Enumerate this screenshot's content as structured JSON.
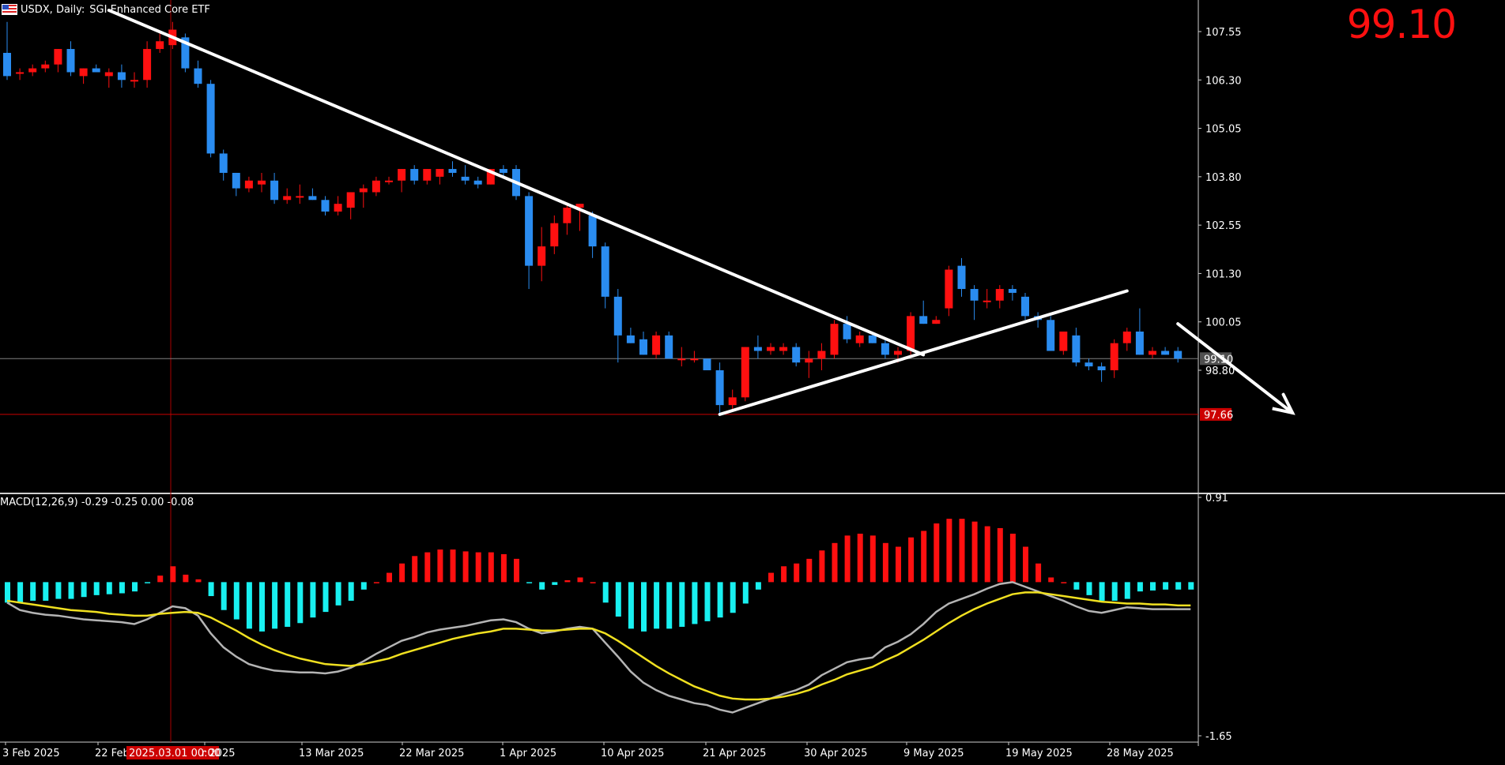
{
  "header": {
    "symbol": "USDX, Daily:",
    "description": "SGI Enhanced Core ETF",
    "flag_icon": "us-flag-icon"
  },
  "last_price": "99.10",
  "colors": {
    "background": "#000000",
    "bull": "#ff1010",
    "bear": "#2a8cf0",
    "hist_pos": "#ff1010",
    "hist_neg": "#19f0f0",
    "macd_line": "#b4b4b4",
    "signal_line": "#f0e020",
    "trendline": "#ffffff",
    "support": "#cc0000"
  },
  "indicator": {
    "label": "MACD(12,26,9) -0.29 -0.25 0.00 -0.08"
  },
  "crosshair_time_label": "2025.03.01 00:00",
  "chart_data": [
    {
      "type": "candlestick",
      "title": "USDX, Daily: SGI Enhanced Core ETF",
      "price_axis_ticks": [
        "107.55",
        "106.30",
        "105.05",
        "103.80",
        "102.55",
        "101.30",
        "100.05",
        "98.80"
      ],
      "price_range": [
        96.6,
        108.0
      ],
      "time_axis_labels": [
        "3 Feb 2025",
        "22 Feb 2025",
        "2025.03.01 00:00",
        "r 2025",
        "13 Mar 2025",
        "22 Mar 2025",
        "1 Apr 2025",
        "10 Apr 2025",
        "21 Apr 2025",
        "30 Apr 2025",
        "9 May 2025",
        "19 May 2025",
        "28 May 2025"
      ],
      "current_price_line": {
        "value": 99.1,
        "label": "99.10"
      },
      "support_line": {
        "value": 97.66,
        "label": "97.66"
      },
      "candles": [
        {
          "o": 107.0,
          "h": 107.8,
          "l": 106.3,
          "c": 106.4
        },
        {
          "o": 106.5,
          "h": 106.6,
          "l": 106.3,
          "c": 106.5
        },
        {
          "o": 106.5,
          "h": 106.7,
          "l": 106.4,
          "c": 106.6
        },
        {
          "o": 106.6,
          "h": 106.8,
          "l": 106.5,
          "c": 106.7
        },
        {
          "o": 106.7,
          "h": 107.1,
          "l": 106.5,
          "c": 107.1
        },
        {
          "o": 107.1,
          "h": 107.3,
          "l": 106.4,
          "c": 106.5
        },
        {
          "o": 106.4,
          "h": 106.6,
          "l": 106.2,
          "c": 106.6
        },
        {
          "o": 106.6,
          "h": 106.7,
          "l": 106.5,
          "c": 106.5
        },
        {
          "o": 106.4,
          "h": 106.6,
          "l": 106.1,
          "c": 106.5
        },
        {
          "o": 106.5,
          "h": 106.7,
          "l": 106.1,
          "c": 106.3
        },
        {
          "o": 106.3,
          "h": 106.5,
          "l": 106.1,
          "c": 106.3
        },
        {
          "o": 106.3,
          "h": 107.3,
          "l": 106.1,
          "c": 107.1
        },
        {
          "o": 107.1,
          "h": 107.5,
          "l": 107.0,
          "c": 107.3
        },
        {
          "o": 107.2,
          "h": 107.8,
          "l": 107.1,
          "c": 107.6
        },
        {
          "o": 107.4,
          "h": 107.5,
          "l": 106.5,
          "c": 106.6
        },
        {
          "o": 106.6,
          "h": 106.8,
          "l": 106.1,
          "c": 106.2
        },
        {
          "o": 106.2,
          "h": 106.3,
          "l": 104.3,
          "c": 104.4
        },
        {
          "o": 104.4,
          "h": 104.5,
          "l": 103.7,
          "c": 103.9
        },
        {
          "o": 103.9,
          "h": 103.9,
          "l": 103.3,
          "c": 103.5
        },
        {
          "o": 103.5,
          "h": 103.8,
          "l": 103.4,
          "c": 103.7
        },
        {
          "o": 103.6,
          "h": 103.9,
          "l": 103.4,
          "c": 103.7
        },
        {
          "o": 103.7,
          "h": 103.9,
          "l": 103.1,
          "c": 103.2
        },
        {
          "o": 103.2,
          "h": 103.5,
          "l": 103.1,
          "c": 103.3
        },
        {
          "o": 103.3,
          "h": 103.6,
          "l": 103.1,
          "c": 103.3
        },
        {
          "o": 103.3,
          "h": 103.5,
          "l": 103.2,
          "c": 103.2
        },
        {
          "o": 103.2,
          "h": 103.3,
          "l": 102.8,
          "c": 102.9
        },
        {
          "o": 102.9,
          "h": 103.3,
          "l": 102.8,
          "c": 103.1
        },
        {
          "o": 103.0,
          "h": 103.4,
          "l": 102.7,
          "c": 103.4
        },
        {
          "o": 103.4,
          "h": 103.6,
          "l": 103.0,
          "c": 103.5
        },
        {
          "o": 103.4,
          "h": 103.8,
          "l": 103.3,
          "c": 103.7
        },
        {
          "o": 103.7,
          "h": 103.8,
          "l": 103.6,
          "c": 103.7
        },
        {
          "o": 103.7,
          "h": 104.0,
          "l": 103.4,
          "c": 104.0
        },
        {
          "o": 104.0,
          "h": 104.1,
          "l": 103.6,
          "c": 103.7
        },
        {
          "o": 103.7,
          "h": 104.0,
          "l": 103.6,
          "c": 104.0
        },
        {
          "o": 103.8,
          "h": 104.0,
          "l": 103.6,
          "c": 104.0
        },
        {
          "o": 104.0,
          "h": 104.2,
          "l": 103.8,
          "c": 103.9
        },
        {
          "o": 103.8,
          "h": 104.1,
          "l": 103.6,
          "c": 103.7
        },
        {
          "o": 103.7,
          "h": 103.8,
          "l": 103.5,
          "c": 103.6
        },
        {
          "o": 103.6,
          "h": 104.0,
          "l": 103.6,
          "c": 104.0
        },
        {
          "o": 104.0,
          "h": 104.1,
          "l": 103.8,
          "c": 103.9
        },
        {
          "o": 104.0,
          "h": 104.1,
          "l": 103.2,
          "c": 103.3
        },
        {
          "o": 103.3,
          "h": 103.4,
          "l": 100.9,
          "c": 101.5
        },
        {
          "o": 101.5,
          "h": 102.5,
          "l": 101.1,
          "c": 102.0
        },
        {
          "o": 102.0,
          "h": 102.8,
          "l": 101.8,
          "c": 102.6
        },
        {
          "o": 102.6,
          "h": 103.1,
          "l": 102.3,
          "c": 103.0
        },
        {
          "o": 103.0,
          "h": 103.1,
          "l": 102.4,
          "c": 103.1
        },
        {
          "o": 102.8,
          "h": 102.9,
          "l": 101.7,
          "c": 102.0
        },
        {
          "o": 102.0,
          "h": 102.1,
          "l": 100.4,
          "c": 100.7
        },
        {
          "o": 100.7,
          "h": 100.9,
          "l": 99.0,
          "c": 99.7
        },
        {
          "o": 99.7,
          "h": 99.9,
          "l": 99.5,
          "c": 99.5
        },
        {
          "o": 99.6,
          "h": 99.8,
          "l": 99.2,
          "c": 99.2
        },
        {
          "o": 99.2,
          "h": 99.8,
          "l": 99.1,
          "c": 99.7
        },
        {
          "o": 99.7,
          "h": 99.8,
          "l": 99.1,
          "c": 99.1
        },
        {
          "o": 99.1,
          "h": 99.4,
          "l": 98.9,
          "c": 99.1
        },
        {
          "o": 99.1,
          "h": 99.3,
          "l": 99.0,
          "c": 99.1
        },
        {
          "o": 99.1,
          "h": 99.1,
          "l": 98.8,
          "c": 98.8
        },
        {
          "o": 98.8,
          "h": 99.0,
          "l": 97.7,
          "c": 97.9
        },
        {
          "o": 97.9,
          "h": 98.3,
          "l": 97.8,
          "c": 98.1
        },
        {
          "o": 98.1,
          "h": 99.4,
          "l": 98.0,
          "c": 99.4
        },
        {
          "o": 99.4,
          "h": 99.7,
          "l": 99.1,
          "c": 99.3
        },
        {
          "o": 99.3,
          "h": 99.5,
          "l": 99.2,
          "c": 99.4
        },
        {
          "o": 99.3,
          "h": 99.5,
          "l": 99.2,
          "c": 99.4
        },
        {
          "o": 99.4,
          "h": 99.5,
          "l": 98.9,
          "c": 99.0
        },
        {
          "o": 99.0,
          "h": 99.3,
          "l": 98.6,
          "c": 99.1
        },
        {
          "o": 99.1,
          "h": 99.5,
          "l": 98.8,
          "c": 99.3
        },
        {
          "o": 99.2,
          "h": 100.1,
          "l": 99.1,
          "c": 100.0
        },
        {
          "o": 100.0,
          "h": 100.2,
          "l": 99.5,
          "c": 99.6
        },
        {
          "o": 99.5,
          "h": 99.8,
          "l": 99.4,
          "c": 99.7
        },
        {
          "o": 99.7,
          "h": 99.8,
          "l": 99.5,
          "c": 99.5
        },
        {
          "o": 99.5,
          "h": 99.6,
          "l": 99.1,
          "c": 99.2
        },
        {
          "o": 99.2,
          "h": 99.4,
          "l": 99.0,
          "c": 99.3
        },
        {
          "o": 99.3,
          "h": 100.3,
          "l": 99.2,
          "c": 100.2
        },
        {
          "o": 100.2,
          "h": 100.6,
          "l": 100.0,
          "c": 100.0
        },
        {
          "o": 100.0,
          "h": 100.2,
          "l": 100.0,
          "c": 100.1
        },
        {
          "o": 100.4,
          "h": 101.5,
          "l": 100.2,
          "c": 101.4
        },
        {
          "o": 101.5,
          "h": 101.7,
          "l": 100.7,
          "c": 100.9
        },
        {
          "o": 100.9,
          "h": 101.0,
          "l": 100.1,
          "c": 100.6
        },
        {
          "o": 100.6,
          "h": 100.9,
          "l": 100.4,
          "c": 100.6
        },
        {
          "o": 100.6,
          "h": 101.0,
          "l": 100.4,
          "c": 100.9
        },
        {
          "o": 100.9,
          "h": 101.0,
          "l": 100.6,
          "c": 100.8
        },
        {
          "o": 100.7,
          "h": 100.8,
          "l": 100.1,
          "c": 100.2
        },
        {
          "o": 100.2,
          "h": 100.3,
          "l": 99.9,
          "c": 100.1
        },
        {
          "o": 100.1,
          "h": 100.2,
          "l": 99.3,
          "c": 99.3
        },
        {
          "o": 99.3,
          "h": 99.8,
          "l": 99.2,
          "c": 99.8
        },
        {
          "o": 99.7,
          "h": 99.9,
          "l": 98.9,
          "c": 99.0
        },
        {
          "o": 99.0,
          "h": 99.1,
          "l": 98.8,
          "c": 98.9
        },
        {
          "o": 98.9,
          "h": 99.0,
          "l": 98.5,
          "c": 98.8
        },
        {
          "o": 98.8,
          "h": 99.6,
          "l": 98.6,
          "c": 99.5
        },
        {
          "o": 99.5,
          "h": 99.9,
          "l": 99.3,
          "c": 99.8
        },
        {
          "o": 99.8,
          "h": 100.4,
          "l": 99.2,
          "c": 99.2
        },
        {
          "o": 99.2,
          "h": 99.4,
          "l": 99.1,
          "c": 99.3
        },
        {
          "o": 99.3,
          "h": 99.4,
          "l": 99.2,
          "c": 99.2
        },
        {
          "o": 99.3,
          "h": 99.4,
          "l": 99.0,
          "c": 99.1
        }
      ],
      "trendlines": [
        {
          "name": "descending-resistance",
          "from": {
            "bar": 8,
            "price": 108.1
          },
          "to": {
            "bar": 72,
            "price": 99.2
          }
        },
        {
          "name": "ascending-support",
          "from": {
            "bar": 56,
            "price": 97.66
          },
          "to": {
            "bar": 88,
            "price": 100.85
          }
        },
        {
          "name": "projection-arrow",
          "from": {
            "bar": 92,
            "price": 100.0
          },
          "to": {
            "bar": 101,
            "price": 97.7
          }
        }
      ]
    },
    {
      "type": "bar",
      "title": "MACD(12,26,9) -0.29 -0.25 0.00 -0.08",
      "value_axis_ticks": [
        "0.91",
        "-1.65"
      ],
      "value_range": [
        -1.65,
        0.91
      ],
      "histogram": [
        -0.22,
        -0.22,
        -0.2,
        -0.2,
        -0.18,
        -0.18,
        -0.16,
        -0.14,
        -0.13,
        -0.12,
        -0.1,
        -0.01,
        0.07,
        0.17,
        0.08,
        0.03,
        -0.15,
        -0.3,
        -0.4,
        -0.5,
        -0.53,
        -0.5,
        -0.48,
        -0.44,
        -0.38,
        -0.32,
        -0.25,
        -0.2,
        -0.08,
        0.0,
        0.1,
        0.2,
        0.28,
        0.32,
        0.35,
        0.35,
        0.33,
        0.32,
        0.32,
        0.3,
        0.25,
        -0.01,
        -0.08,
        -0.03,
        0.02,
        0.05,
        0.0,
        -0.22,
        -0.37,
        -0.5,
        -0.53,
        -0.5,
        -0.5,
        -0.48,
        -0.45,
        -0.42,
        -0.38,
        -0.33,
        -0.23,
        -0.08,
        0.1,
        0.17,
        0.2,
        0.25,
        0.34,
        0.42,
        0.5,
        0.52,
        0.5,
        0.42,
        0.38,
        0.48,
        0.55,
        0.63,
        0.68,
        0.68,
        0.65,
        0.6,
        0.58,
        0.52,
        0.38,
        0.2,
        0.05,
        0.0,
        -0.08,
        -0.14,
        -0.2,
        -0.2,
        -0.18,
        -0.1,
        -0.09,
        -0.08,
        -0.08,
        -0.08
      ],
      "macd_line": [
        -0.22,
        -0.3,
        -0.33,
        -0.35,
        -0.36,
        -0.38,
        -0.4,
        -0.41,
        -0.42,
        -0.43,
        -0.45,
        -0.4,
        -0.33,
        -0.26,
        -0.28,
        -0.36,
        -0.55,
        -0.7,
        -0.8,
        -0.88,
        -0.92,
        -0.95,
        -0.96,
        -0.97,
        -0.97,
        -0.98,
        -0.96,
        -0.92,
        -0.85,
        -0.77,
        -0.7,
        -0.63,
        -0.59,
        -0.54,
        -0.51,
        -0.49,
        -0.47,
        -0.44,
        -0.41,
        -0.4,
        -0.43,
        -0.5,
        -0.55,
        -0.53,
        -0.5,
        -0.48,
        -0.5,
        -0.65,
        -0.8,
        -0.96,
        -1.08,
        -1.16,
        -1.22,
        -1.26,
        -1.3,
        -1.32,
        -1.37,
        -1.4,
        -1.35,
        -1.3,
        -1.25,
        -1.2,
        -1.16,
        -1.1,
        -1.0,
        -0.93,
        -0.86,
        -0.83,
        -0.81,
        -0.7,
        -0.64,
        -0.56,
        -0.45,
        -0.32,
        -0.23,
        -0.18,
        -0.13,
        -0.07,
        -0.02,
        0.0,
        -0.05,
        -0.1,
        -0.15,
        -0.2,
        -0.26,
        -0.31,
        -0.33,
        -0.3,
        -0.27,
        -0.28,
        -0.29,
        -0.29,
        -0.29,
        -0.29
      ],
      "signal_line": [
        -0.2,
        -0.22,
        -0.24,
        -0.26,
        -0.28,
        -0.3,
        -0.31,
        -0.32,
        -0.34,
        -0.35,
        -0.36,
        -0.36,
        -0.34,
        -0.33,
        -0.32,
        -0.33,
        -0.38,
        -0.45,
        -0.52,
        -0.6,
        -0.67,
        -0.73,
        -0.78,
        -0.82,
        -0.85,
        -0.88,
        -0.89,
        -0.9,
        -0.88,
        -0.85,
        -0.82,
        -0.77,
        -0.73,
        -0.69,
        -0.65,
        -0.61,
        -0.58,
        -0.55,
        -0.53,
        -0.5,
        -0.5,
        -0.51,
        -0.52,
        -0.52,
        -0.51,
        -0.5,
        -0.5,
        -0.55,
        -0.63,
        -0.72,
        -0.81,
        -0.9,
        -0.98,
        -1.05,
        -1.12,
        -1.17,
        -1.22,
        -1.25,
        -1.26,
        -1.26,
        -1.25,
        -1.23,
        -1.2,
        -1.16,
        -1.1,
        -1.05,
        -0.99,
        -0.95,
        -0.91,
        -0.84,
        -0.78,
        -0.7,
        -0.62,
        -0.53,
        -0.44,
        -0.36,
        -0.29,
        -0.23,
        -0.18,
        -0.13,
        -0.11,
        -0.11,
        -0.13,
        -0.15,
        -0.17,
        -0.19,
        -0.21,
        -0.22,
        -0.23,
        -0.23,
        -0.24,
        -0.24,
        -0.25,
        -0.25
      ]
    }
  ]
}
